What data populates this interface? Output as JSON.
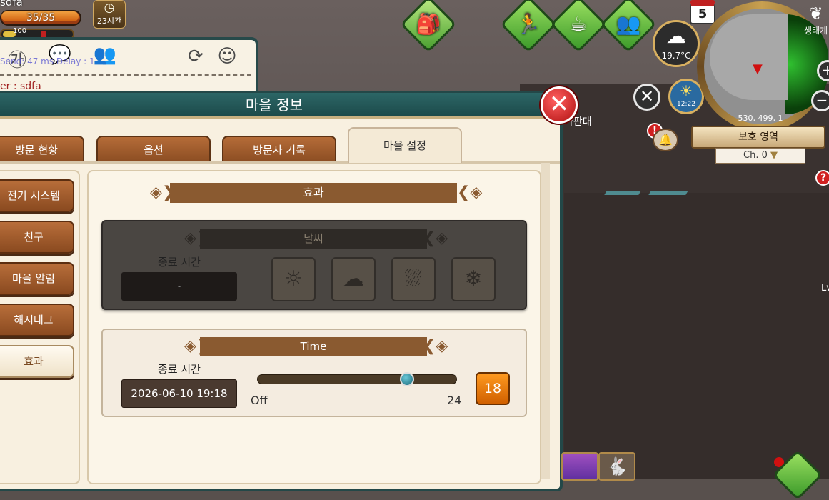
{
  "player": {
    "name": "sdfa",
    "hp": "35/35",
    "xp": "100",
    "timer": "23시간"
  },
  "chat": {
    "line1": "Send: 47 ms Delay : 1",
    "line2": "er : sdfa"
  },
  "hud": {
    "temperature": "19.7°C",
    "time": "12:22",
    "calendar_day": "5",
    "coords": "530, 499, 1",
    "zone": "보호 영역",
    "channel": "Ch. 0",
    "eco_label": "생태계",
    "right_label": "가판대",
    "lv_label": "Lv"
  },
  "window": {
    "title": "마을 정보",
    "tabs": [
      {
        "label": "방문 현황"
      },
      {
        "label": "옵션"
      },
      {
        "label": "방문자 기록"
      },
      {
        "label": "마을 설정"
      }
    ],
    "sidebar": [
      {
        "label": "전기 시스템"
      },
      {
        "label": "친구"
      },
      {
        "label": "마을 알림"
      },
      {
        "label": "해시태그"
      },
      {
        "label": "효과"
      }
    ],
    "section_title": "효과",
    "weather": {
      "title": "날씨",
      "end_time_label": "종료 시간",
      "end_time_value": "-",
      "options": [
        "sun",
        "cloud",
        "rain",
        "snow"
      ]
    },
    "time": {
      "title": "Time",
      "end_time_label": "종료 시간",
      "end_time_value": "2026-06-10 19:18",
      "min_label": "Off",
      "max_label": "24",
      "value": "18",
      "slider_fraction": 0.75
    }
  },
  "colors": {
    "tab_brown": "#8a4c22",
    "header_teal": "#1c4a4a",
    "close_red": "#c01010",
    "value_orange": "#ff9a20"
  }
}
